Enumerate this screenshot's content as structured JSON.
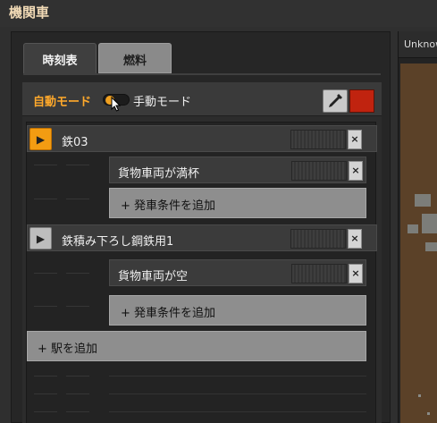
{
  "window": {
    "title": "機関車"
  },
  "tabs": [
    {
      "label": "時刻表",
      "active": true
    },
    {
      "label": "燃料",
      "active": false
    }
  ],
  "mode": {
    "auto_label": "自動モード",
    "manual_label": "手動モード",
    "auto_selected": true,
    "swatch_color": "#c0230f"
  },
  "schedule": {
    "stations": [
      {
        "name": "鉄03",
        "active": true,
        "conditions": [
          {
            "label": "貨物車両が満杯"
          }
        ],
        "add_condition_label": "+ 発車条件を追加"
      },
      {
        "name": "鉄積み下ろし鋼鉄用1",
        "active": false,
        "conditions": [
          {
            "label": "貨物車両が空"
          }
        ],
        "add_condition_label": "+ 発車条件を追加"
      }
    ],
    "add_station_label": "+ 駅を追加",
    "close_symbol": "×",
    "play_symbol": "▶"
  },
  "map": {
    "header": "Unknown"
  },
  "colors": {
    "accent": "#ffa92b",
    "active_station": "#f39c12"
  }
}
